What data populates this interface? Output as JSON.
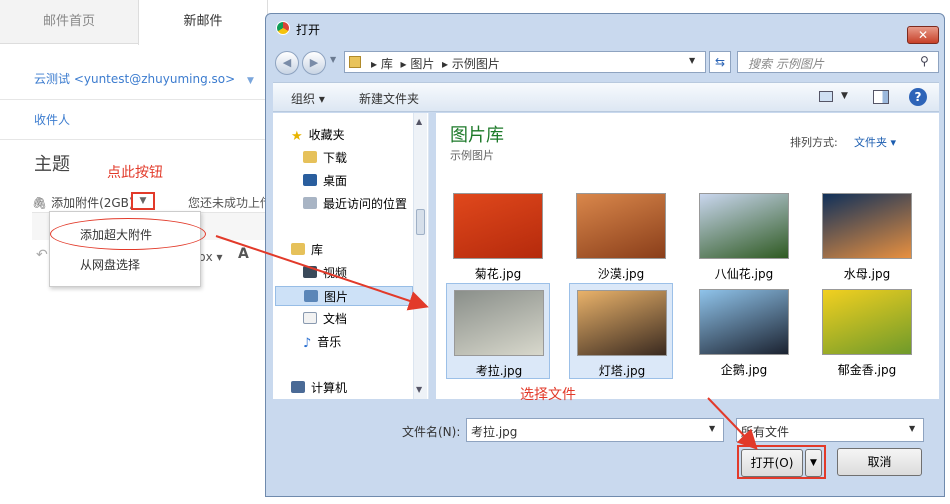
{
  "mail": {
    "tabs": [
      "邮件首页",
      "新邮件"
    ],
    "from": "云测试 <yuntest@zhuyuming.so>",
    "to_label": "收件人",
    "subject_label": "主题",
    "attach_label": "添加附件(2GB)",
    "attach_status": "您还未成功上传",
    "font_size_label": "px",
    "font_label": "A",
    "dropdown": [
      "添加超大附件",
      "从网盘选择"
    ]
  },
  "annotations": {
    "click_here": "点此按钮",
    "choose_file": "选择文件",
    "color": "#e23a2a"
  },
  "dialog": {
    "title": "打开",
    "breadcrumb": [
      "库",
      "图片",
      "示例图片"
    ],
    "search_placeholder": "搜索 示例图片",
    "toolbar": {
      "organize": "组织",
      "new_folder": "新建文件夹"
    },
    "nav": {
      "favorites": "收藏夹",
      "downloads": "下载",
      "desktop": "桌面",
      "recent": "最近访问的位置",
      "libraries": "库",
      "videos": "视频",
      "pictures": "图片",
      "documents": "文档",
      "music": "音乐",
      "computer": "计算机"
    },
    "library_title": "图片库",
    "library_sub": "示例图片",
    "sort_label": "排列方式:",
    "sort_value": "文件夹",
    "files": [
      {
        "name": "菊花.jpg",
        "colors": [
          "#e0481c",
          "#b52a0c"
        ]
      },
      {
        "name": "沙漠.jpg",
        "colors": [
          "#d9874b",
          "#8a3e1a"
        ]
      },
      {
        "name": "八仙花.jpg",
        "colors": [
          "#c9d6ee",
          "#2f5a22"
        ]
      },
      {
        "name": "水母.jpg",
        "colors": [
          "#10305a",
          "#e89040"
        ]
      },
      {
        "name": "考拉.jpg",
        "colors": [
          "#8a8f8a",
          "#d8d8cc"
        ]
      },
      {
        "name": "灯塔.jpg",
        "colors": [
          "#e9b26a",
          "#3a2a20"
        ]
      },
      {
        "name": "企鹅.jpg",
        "colors": [
          "#8fc3ea",
          "#1b2230"
        ]
      },
      {
        "name": "郁金香.jpg",
        "colors": [
          "#f2d020",
          "#6f9a2a"
        ]
      }
    ],
    "filename_label": "文件名(N):",
    "filename_value": "考拉.jpg",
    "filter_value": "所有文件",
    "open_label": "打开(O)",
    "cancel_label": "取消"
  }
}
